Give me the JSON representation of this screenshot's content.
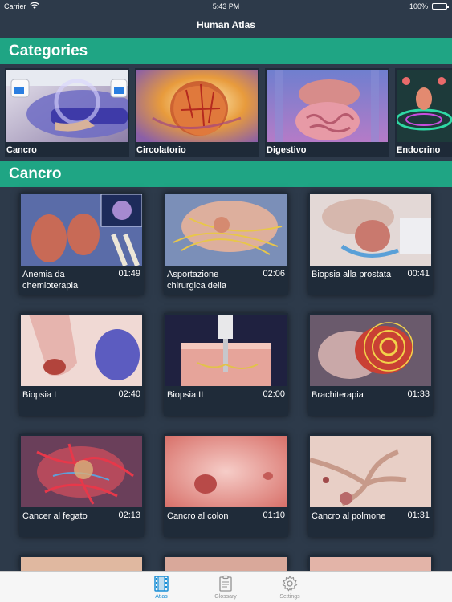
{
  "status_bar": {
    "carrier": "Carrier",
    "wifi_icon": "wifi-icon",
    "time": "5:43 PM",
    "battery": "100%",
    "battery_level": 1.0
  },
  "nav": {
    "title": "Human Atlas"
  },
  "categories_section": {
    "title": "Categories",
    "items": [
      {
        "label": "Cancro"
      },
      {
        "label": "Circolatorio"
      },
      {
        "label": "Digestivo"
      },
      {
        "label": "Endocrino"
      }
    ]
  },
  "cancro_section": {
    "title": "Cancro",
    "videos": [
      {
        "title": "Anemia da chemioterapia",
        "duration": "01:49"
      },
      {
        "title": "Asportazione chirurgica della",
        "duration": "02:06"
      },
      {
        "title": "Biopsia alla prostata",
        "duration": "00:41"
      },
      {
        "title": "Biopsia I",
        "duration": "02:40"
      },
      {
        "title": "Biopsia II",
        "duration": "02:00"
      },
      {
        "title": "Brachiterapia",
        "duration": "01:33"
      },
      {
        "title": "Cancer al fegato",
        "duration": "02:13"
      },
      {
        "title": "Cancro al colon",
        "duration": "01:10"
      },
      {
        "title": "Cancro al polmone",
        "duration": "01:31"
      }
    ]
  },
  "tab_bar": {
    "tabs": [
      {
        "label": "Atlas",
        "icon": "film-icon",
        "active": true
      },
      {
        "label": "Glossary",
        "icon": "clipboard-icon",
        "active": false
      },
      {
        "label": "Settings",
        "icon": "gear-icon",
        "active": false
      }
    ],
    "active_color": "#1a8fd6"
  },
  "colors": {
    "background": "#2d3a4a",
    "section_header": "#1fa584"
  }
}
